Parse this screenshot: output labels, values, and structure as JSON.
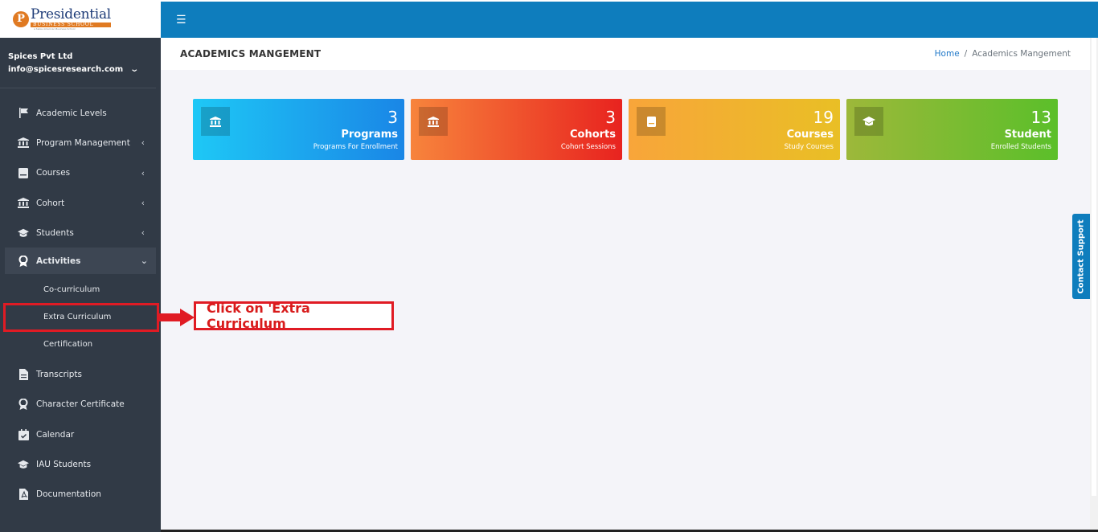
{
  "brand": {
    "logo_letter": "P",
    "name": "Presidential",
    "sub": "BUSINESS SCHOOL",
    "tagline": "a Swiss American Business School"
  },
  "user": {
    "org": "Spices Pvt Ltd",
    "email": "info@spicesresearch.com"
  },
  "nav": {
    "items": [
      {
        "label": "Academic Levels",
        "icon": "flag-icon"
      },
      {
        "label": "Program Management",
        "icon": "institution-icon"
      },
      {
        "label": "Courses",
        "icon": "book-icon"
      },
      {
        "label": "Cohort",
        "icon": "institution-icon"
      },
      {
        "label": "Students",
        "icon": "graduation-cap-icon"
      },
      {
        "label": "Activities",
        "icon": "award-icon"
      },
      {
        "label": "Transcripts",
        "icon": "file-icon"
      },
      {
        "label": "Character Certificate",
        "icon": "award-icon"
      },
      {
        "label": "Calendar",
        "icon": "calendar-check-icon"
      },
      {
        "label": "IAU Students",
        "icon": "graduation-cap-icon"
      },
      {
        "label": "Documentation",
        "icon": "file-pdf-icon"
      }
    ],
    "activities_sub": [
      "Co-curriculum",
      "Extra Curriculum",
      "Certification"
    ]
  },
  "header": {
    "title": "ACADEMICS MANGEMENT",
    "breadcrumb_home": "Home",
    "breadcrumb_sep": "/",
    "breadcrumb_current": "Academics Mangement"
  },
  "cards": [
    {
      "count": "3",
      "label": "Programs",
      "sub": "Programs For Enrollment"
    },
    {
      "count": "3",
      "label": "Cohorts",
      "sub": "Cohort Sessions"
    },
    {
      "count": "19",
      "label": "Courses",
      "sub": "Study Courses"
    },
    {
      "count": "13",
      "label": "Student",
      "sub": "Enrolled Students"
    }
  ],
  "callout": "Click on 'Extra Curriculum",
  "contact_support": "Contact Support",
  "colors": {
    "sidebar": "#313a46",
    "topbar": "#0e7dbd",
    "highlight": "#e01b24"
  }
}
